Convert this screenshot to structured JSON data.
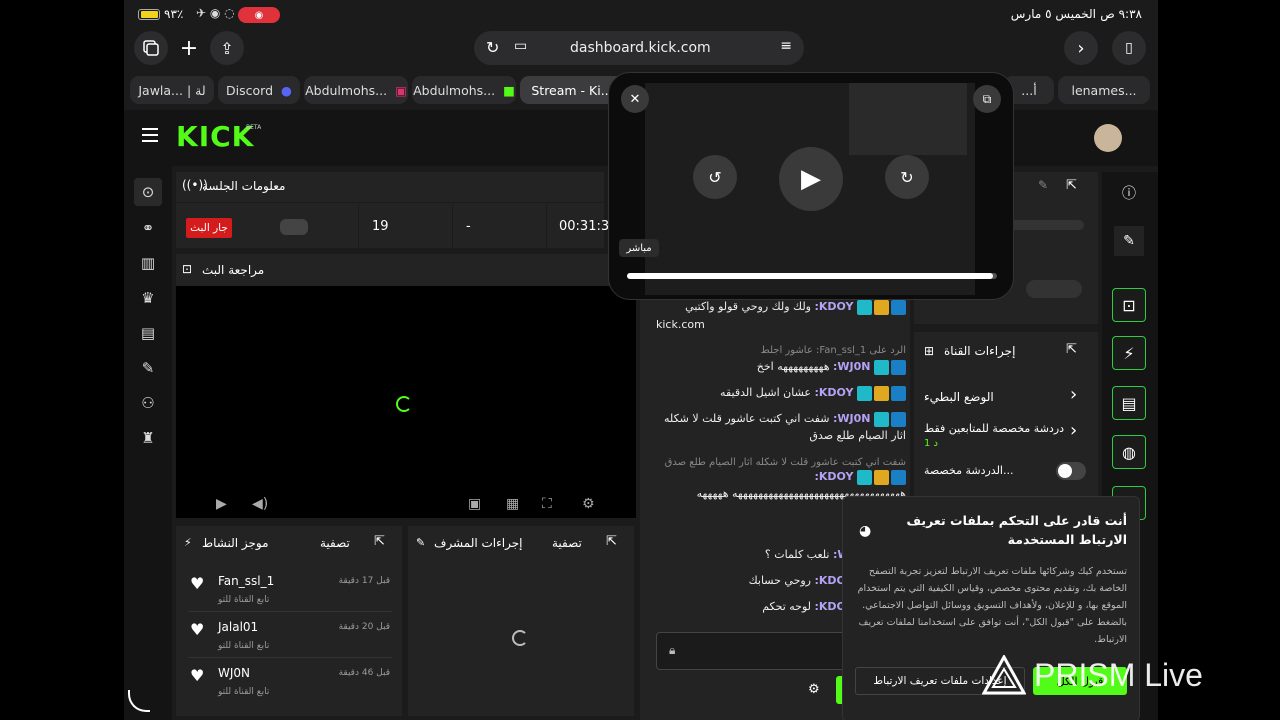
{
  "status_bar": {
    "time": "٩:٣٨ ص",
    "date": "الخميس ٥ مارس",
    "battery": "٩٣٪"
  },
  "browser": {
    "url": "dashboard.kick.com",
    "tabs": [
      {
        "label": "Jawla... | لة"
      },
      {
        "label": "Discord"
      },
      {
        "label": "Abdulmohs..."
      },
      {
        "label": "Abdulmohs..."
      },
      {
        "label": "Stream - Ki..."
      },
      {
        "label": "...أ"
      },
      {
        "label": "lenames..."
      }
    ]
  },
  "kick": {
    "logo": "KICK",
    "beta": "BETA"
  },
  "session_info": {
    "title": "معلومات الجلسة",
    "live_badge": "جار البث",
    "viewers": "19",
    "followers": "-",
    "duration": "00:31:3"
  },
  "stream_preview": {
    "title": "مراجعة البث"
  },
  "video_overlay": {
    "live_label": "مباشر",
    "progress": 0.99
  },
  "chat": {
    "partial_top": "kick.com",
    "messages": [
      {
        "reply": "",
        "user": "KDOY:",
        "text": "ولك ولك روحي قولو واكتبي",
        "badges": [
          "blue",
          "gold",
          "og"
        ]
      },
      {
        "reply": "الرد على Fan_ssl_1: عاشور اجلط",
        "user": "WJ0N:",
        "text": "هههههههههه اخخ",
        "badges": [
          "blue",
          "og"
        ]
      },
      {
        "reply": "",
        "user": "KDOY:",
        "text": "عشان اشيل الدقيقه",
        "badges": [
          "blue",
          "gold",
          "og"
        ]
      },
      {
        "reply": "",
        "user": "WJ0N:",
        "text": "شفت اني كتبت عاشور قلت لا شكله اثار الصيام طلع صدق",
        "badges": [
          "blue",
          "og"
        ]
      },
      {
        "reply": "شفت اني كتبت عاشور قلت لا شكله اثار الصيام طلع صدق ...",
        "user": "KDOY:",
        "text": "هههههههههههههههههههههههههههههههههه هههههه",
        "badges": [
          "blue",
          "gold",
          "og"
        ]
      },
      {
        "reply": "",
        "user": "WJ0N:",
        "text": "نلعب كلمات ؟",
        "badges": [
          "blue",
          "og"
        ]
      },
      {
        "reply": "",
        "user": "KDOY:",
        "text": "روحي حسابك",
        "badges": [
          "blue",
          "gold",
          "og"
        ]
      },
      {
        "reply": "",
        "user": "KDOY:",
        "text": "لوحه تحكم",
        "badges": [
          "blue",
          "gold",
          "og"
        ]
      }
    ]
  },
  "channel_actions": {
    "title": "إجراءات القناة",
    "slow_mode": "الوضع البطيء",
    "followers_only": "دردشة مخصصة للمتابعين فقط",
    "followers_sub": "1 د",
    "custom_chat": "الدردشة مخصصة..."
  },
  "activity": {
    "title": "موجز النشاط",
    "filter": "تصفية",
    "items": [
      {
        "user": "Fan_ssl_1",
        "time": "قبل 17 دقيقة",
        "action": "تابع القناة للتو"
      },
      {
        "user": "Jalal01",
        "time": "قبل 20 دقيقة",
        "action": "تابع القناة للتو"
      },
      {
        "user": "WJ0N",
        "time": "قبل 46 دقيقة",
        "action": "تابع القناة للتو"
      }
    ]
  },
  "moderator": {
    "title": "إجراءات المشرف",
    "filter": "تصفية"
  },
  "cookie": {
    "title": "أنت قادر على التحكم بملفات تعريف الارتباط المستخدمة",
    "body": "تستخدم كيك وشركائها ملفات تعريف الارتباط لتعزيز تجربة التصفح الخاصة بك، وتقديم محتوى مخصص، وقياس الكيفية التي يتم استخدام الموقع بها، و للإعلان، ولأهداف التسويق ووسائل التواصل الاجتماعي. بالضغط على \"قبول الكل\"، أنت توافق على استخدامنا لملفات تعريف الارتباط.",
    "settings_button": "إعدادات ملفات تعريف الارتباط",
    "accept_button": "قبول الكل"
  },
  "watermark": {
    "text": "PRISM Live"
  },
  "colors": {
    "accent": "#53fc18",
    "live": "#d41c1c",
    "panel": "#232323"
  }
}
